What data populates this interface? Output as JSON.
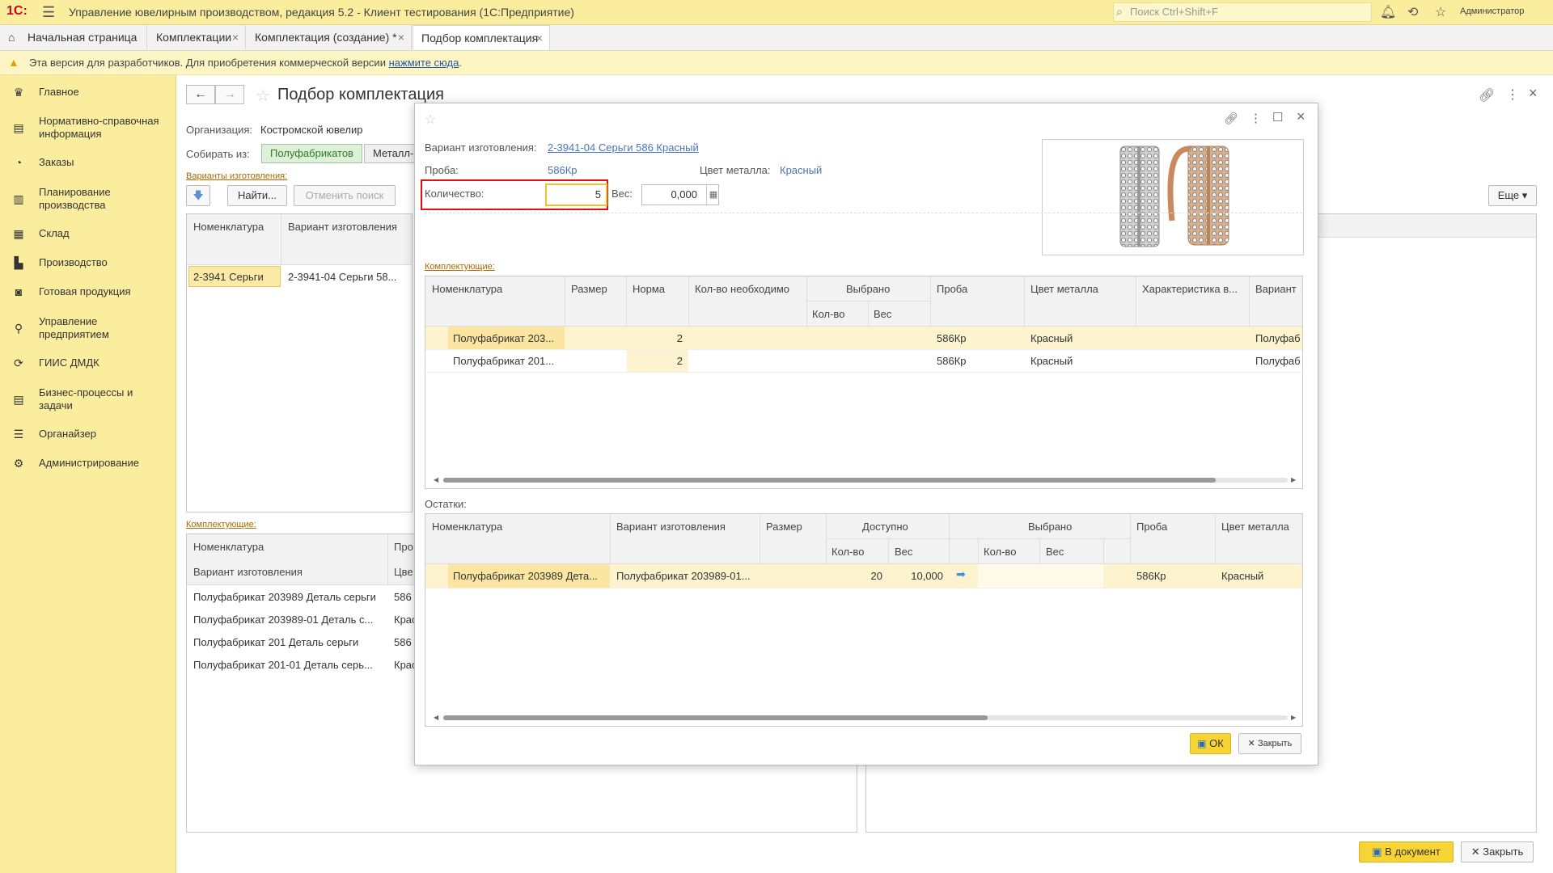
{
  "titlebar": {
    "logo": "1С:",
    "title": "Управление ювелирным производством, редакция 5.2  - Клиент тестирования (1С:Предприятие)",
    "search_placeholder": "Поиск Ctrl+Shift+F",
    "user": "Администратор"
  },
  "tabs": [
    {
      "label": "Начальная страница"
    },
    {
      "label": "Комплектации"
    },
    {
      "label": "Комплектация (создание) *"
    },
    {
      "label": "Подбор комплектация"
    }
  ],
  "banner": {
    "text": "Эта версия для разработчиков. Для приобретения коммерческой версии",
    "link": "нажмите сюда",
    "tail": "."
  },
  "sidebar": {
    "items": [
      {
        "label": "Главное",
        "icon": "crown-icon"
      },
      {
        "label": "Нормативно-справочная информация",
        "icon": "book-icon"
      },
      {
        "label": "Заказы",
        "icon": "pie-icon"
      },
      {
        "label": "Планирование производства",
        "icon": "clipboard-icon"
      },
      {
        "label": "Склад",
        "icon": "grid-icon"
      },
      {
        "label": "Производство",
        "icon": "factory-icon"
      },
      {
        "label": "Готовая продукция",
        "icon": "bag-icon"
      },
      {
        "label": "Управление предприятием",
        "icon": "org-icon"
      },
      {
        "label": "ГИИС ДМДК",
        "icon": "sync-icon"
      },
      {
        "label": "Бизнес-процессы и задачи",
        "icon": "list-icon"
      },
      {
        "label": "Органайзер",
        "icon": "sliders-icon"
      },
      {
        "label": "Администрирование",
        "icon": "gear-icon"
      }
    ]
  },
  "main": {
    "title": "Подбор комплектация",
    "org_label": "Организация:",
    "org_value": "Костромской ювелир",
    "collect_label": "Собирать из:",
    "collect_options": [
      "Полуфабрикатов",
      "Металл-"
    ],
    "variants_link": "Варианты изготовления:",
    "find_btn": "Найти...",
    "cancel_search_btn": "Отменить поиск",
    "more_btn": "Еще",
    "variants_grid": {
      "headers": [
        "Номенклатура",
        "Вариант изготовления"
      ],
      "rows": [
        [
          "2-3941 Серьги",
          "2-3941-04 Серьги 58..."
        ]
      ]
    },
    "components_link": "Комплектующие:",
    "components_grid": {
      "headers": [
        "Номенклатура",
        "Про"
      ],
      "subheaders": [
        "Вариант изготовления",
        "Цве"
      ],
      "rows": [
        [
          "Полуфабрикат 203989 Деталь серьги",
          "586"
        ],
        [
          "Полуфабрикат 203989-01 Деталь с...",
          "Крас"
        ],
        [
          "Полуфабрикат 201 Деталь серьги",
          "586"
        ],
        [
          "Полуфабрикат 201-01 Деталь серь...",
          "Крас"
        ]
      ]
    },
    "to_doc_btn": "В документ",
    "close_btn": "Закрыть"
  },
  "modal": {
    "variant_label": "Вариант изготовления:",
    "variant_value": "2-3941-04 Серьги 586 Красный",
    "proba_label": "Проба:",
    "proba_value": "586Кр",
    "metal_label": "Цвет металла:",
    "metal_value": "Красный",
    "qty_label": "Количество:",
    "qty_value": "5",
    "weight_label": "Вес:",
    "weight_value": "0,000",
    "components_link": "Комплектующие:",
    "components": {
      "headers": [
        "Номенклатура",
        "Размер",
        "Норма",
        "Кол-во  необходимо",
        "Выбрано",
        "Проба",
        "Цвет металла",
        "Характеристика в...",
        "Вариант"
      ],
      "subheaders": [
        "Кол-во",
        "Вес"
      ],
      "rows": [
        {
          "name": "Полуфабрикат 203...",
          "norm": "2",
          "proba": "586Кр",
          "metal": "Красный",
          "variant": "Полуфаб"
        },
        {
          "name": "Полуфабрикат 201...",
          "norm": "2",
          "proba": "586Кр",
          "metal": "Красный",
          "variant": "Полуфаб"
        }
      ]
    },
    "remains_label": "Остатки:",
    "remains": {
      "headers": [
        "Номенклатура",
        "Вариант изготовления",
        "Размер",
        "Доступно",
        "Выбрано",
        "Проба",
        "Цвет металла"
      ],
      "subheaders": [
        "Кол-во",
        "Вес",
        "Кол-во",
        "Вес"
      ],
      "rows": [
        {
          "name": "Полуфабрикат 203989 Дета...",
          "variant": "Полуфабрикат 203989-01...",
          "qty": "20",
          "weight": "10,000",
          "proba": "586Кр",
          "metal": "Красный"
        }
      ]
    },
    "ok_btn": "ОК",
    "close_btn": "Закрыть"
  }
}
